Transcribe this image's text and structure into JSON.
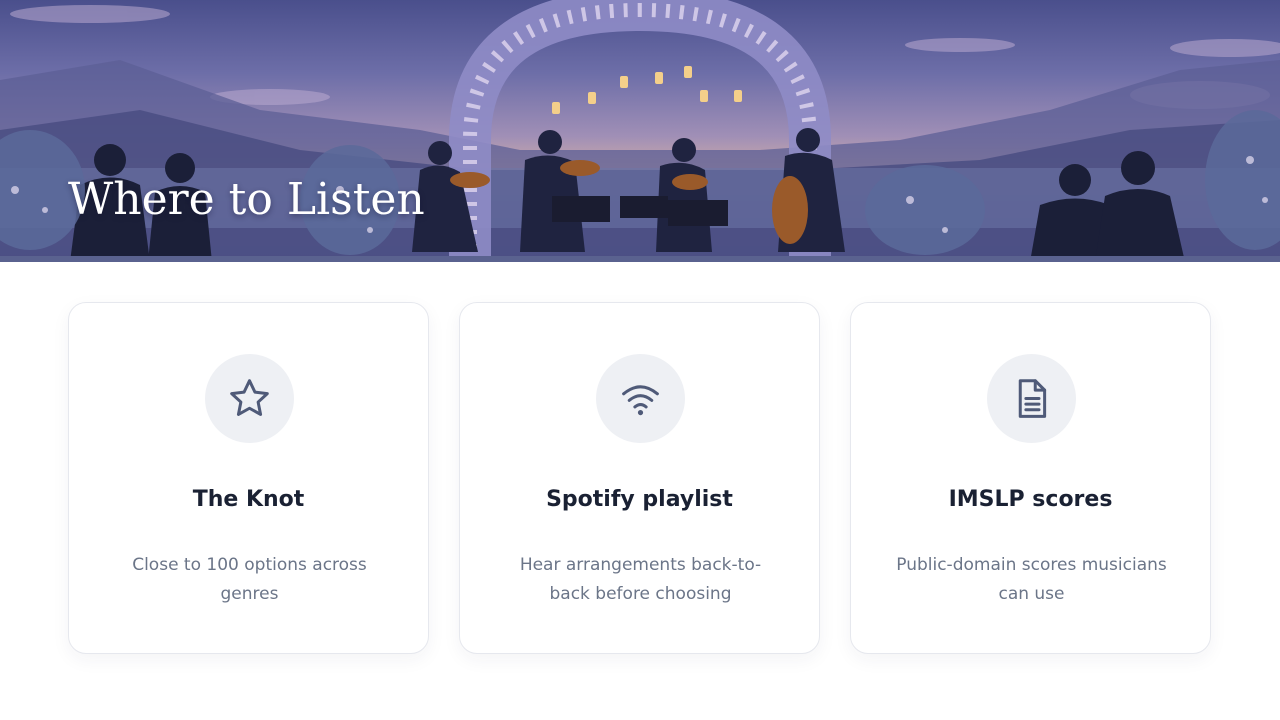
{
  "hero": {
    "title": "Where to Listen",
    "image": "string-quartet-under-floral-arch-at-dusk"
  },
  "cards": [
    {
      "icon": "star-icon",
      "title": "The Knot",
      "description": "Close to 100 options across genres"
    },
    {
      "icon": "wifi-icon",
      "title": "Spotify playlist",
      "description": "Hear arrangements back-to-back before choosing"
    },
    {
      "icon": "document-icon",
      "title": "IMSLP scores",
      "description": "Public-domain scores musicians can use"
    }
  ],
  "colors": {
    "accent": "#5a628f",
    "icon_stroke": "#4f5a78",
    "icon_bg": "#eef0f4",
    "title_text": "#1a2133",
    "body_text": "#6b7588",
    "card_border": "#e6e8ee"
  }
}
